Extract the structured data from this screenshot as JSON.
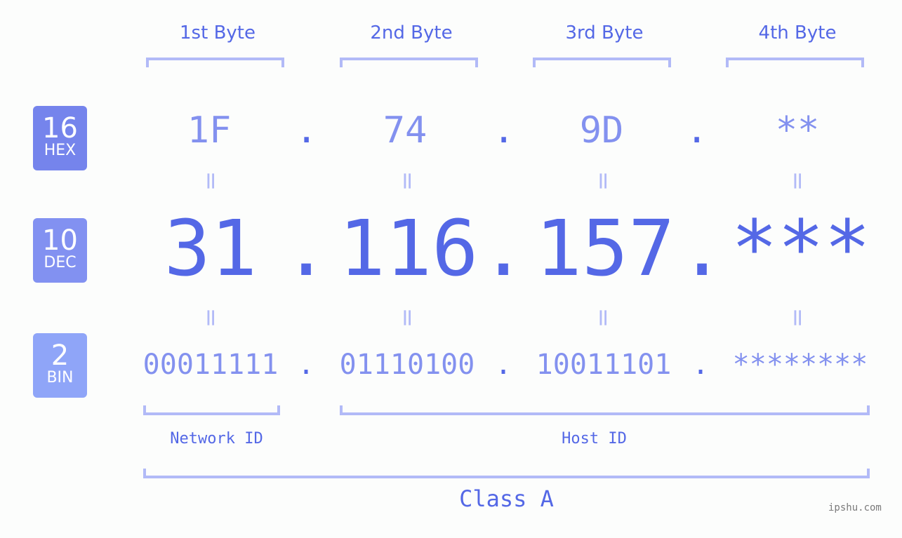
{
  "bytes": [
    {
      "label": "1st Byte",
      "hex": "1F",
      "dec": "31",
      "bin": "00011111"
    },
    {
      "label": "2nd Byte",
      "hex": "74",
      "dec": "116",
      "bin": "01110100"
    },
    {
      "label": "3rd Byte",
      "hex": "9D",
      "dec": "157",
      "bin": "10011101"
    },
    {
      "label": "4th Byte",
      "hex": "**",
      "dec": "***",
      "bin": "********"
    }
  ],
  "separator": ".",
  "equals": "=",
  "badges": {
    "hex": {
      "num": "16",
      "name": "HEX",
      "color": "#7584ec"
    },
    "dec": {
      "num": "10",
      "name": "DEC",
      "color": "#8291f1"
    },
    "bin": {
      "num": "2",
      "name": "BIN",
      "color": "#8fa5f8"
    }
  },
  "network_id_label": "Network ID",
  "host_id_label": "Host ID",
  "class_label": "Class A",
  "watermark": "ipshu.com",
  "colors": {
    "primary": "#5468e6",
    "secondary": "#8391ef",
    "bracket": "#b2baf7",
    "background": "#fcfdfc"
  }
}
